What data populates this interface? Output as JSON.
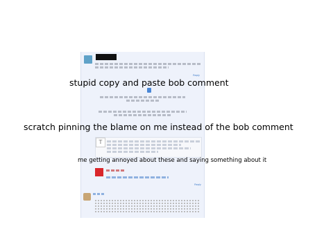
{
  "captions": {
    "copy_paste": "stupid copy and paste bob comment",
    "pinning": "scratch pinning the blame on me instead of the bob comment",
    "annoyed": "me getting annoyed about these and saying something about it"
  },
  "comments": {
    "top_reply_label": "Reply",
    "red_user_label": "",
    "second_reply_label": "Reply"
  },
  "reply_box": {
    "icon": "T"
  },
  "colors": {
    "panel_bg": "#eef2fb",
    "red": "#d9262b",
    "link": "#3a78c8"
  },
  "icons": {
    "pin": "pin-icon",
    "avatar": "avatar"
  }
}
